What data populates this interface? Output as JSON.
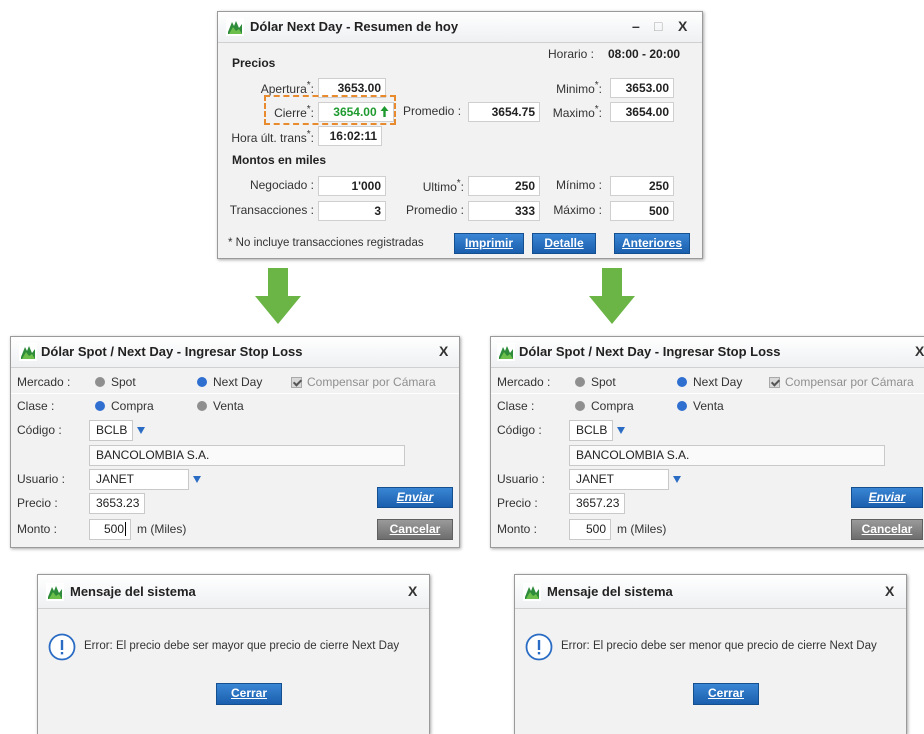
{
  "summary_window": {
    "title": "Dólar Next Day - Resumen de hoy",
    "horario_label": "Horario :",
    "horario_value": "08:00 - 20:00",
    "precios_label": "Precios",
    "apertura_label": "Apertura",
    "apertura_value": "3653.00",
    "cierre_label": "Cierre",
    "cierre_value": "3654.00",
    "promedio_label": "Promedio :",
    "promedio_value": "3654.75",
    "minimo_label": "Minimo",
    "minimo_value": "3653.00",
    "maximo_label": "Maximo",
    "maximo_value": "3654.00",
    "hora_label": "Hora últ. trans",
    "hora_value": "16:02:11",
    "montos_label": "Montos en miles",
    "negociado_label": "Negociado :",
    "negociado_value": "1'000",
    "ultimo_label": "Ultimo",
    "ultimo_value": "250",
    "minimo2_label": "Mínimo :",
    "minimo2_value": "250",
    "transacciones_label": "Transacciones :",
    "transacciones_value": "3",
    "promedio2_label": "Promedio :",
    "promedio2_value": "333",
    "maximo2_label": "Máximo :",
    "maximo2_value": "500",
    "footnote": "* No incluye transacciones registradas",
    "btn_imprimir": "Imprimir",
    "btn_detalle": "Detalle",
    "btn_anteriores": "Anteriores",
    "asterisk": "*",
    "minimize_glyph": "–",
    "maximize_glyph": "□",
    "close_glyph": "X"
  },
  "stop_loss_left": {
    "title": "Dólar Spot / Next Day - Ingresar Stop Loss",
    "mercado_label": "Mercado :",
    "spot_label": "Spot",
    "nextday_label": "Next Day",
    "compensar_label": "Compensar por Cámara",
    "clase_label": "Clase :",
    "compra_label": "Compra",
    "venta_label": "Venta",
    "codigo_label": "Código :",
    "codigo_value": "BCLB",
    "company_value": "BANCOLOMBIA S.A.",
    "usuario_label": "Usuario :",
    "usuario_value": "JANET",
    "precio_label": "Precio :",
    "precio_value": "3653.23",
    "monto_label": "Monto :",
    "monto_value": "500",
    "monto_unit": "m (Miles)",
    "btn_enviar": "Enviar",
    "btn_cancelar": "Cancelar",
    "close_glyph": "X"
  },
  "stop_loss_right": {
    "title": "Dólar Spot / Next Day - Ingresar Stop Loss",
    "mercado_label": "Mercado :",
    "spot_label": "Spot",
    "nextday_label": "Next Day",
    "compensar_label": "Compensar por Cámara",
    "clase_label": "Clase :",
    "compra_label": "Compra",
    "venta_label": "Venta",
    "codigo_label": "Código :",
    "codigo_value": "BCLB",
    "company_value": "BANCOLOMBIA S.A.",
    "usuario_label": "Usuario :",
    "usuario_value": "JANET",
    "precio_label": "Precio :",
    "precio_value": "3657.23",
    "monto_label": "Monto :",
    "monto_value": "500",
    "monto_unit": "m (Miles)",
    "btn_enviar": "Enviar",
    "btn_cancelar": "Cancelar",
    "close_glyph": "X"
  },
  "msg_left": {
    "title": "Mensaje del sistema",
    "icon_glyph": "!",
    "message": "Error: El precio debe ser mayor que precio de cierre Next Day",
    "btn_cerrar": "Cerrar",
    "close_glyph": "X"
  },
  "msg_right": {
    "title": "Mensaje del sistema",
    "icon_glyph": "!",
    "message": "Error: El precio debe ser menor que precio de cierre Next Day",
    "btn_cerrar": "Cerrar",
    "close_glyph": "X"
  },
  "colors": {
    "accent_blue": "#1a5fae",
    "arrow_green": "#6ab545",
    "highlight_orange": "#e88a2e",
    "cierre_green": "#1f9a2f"
  }
}
